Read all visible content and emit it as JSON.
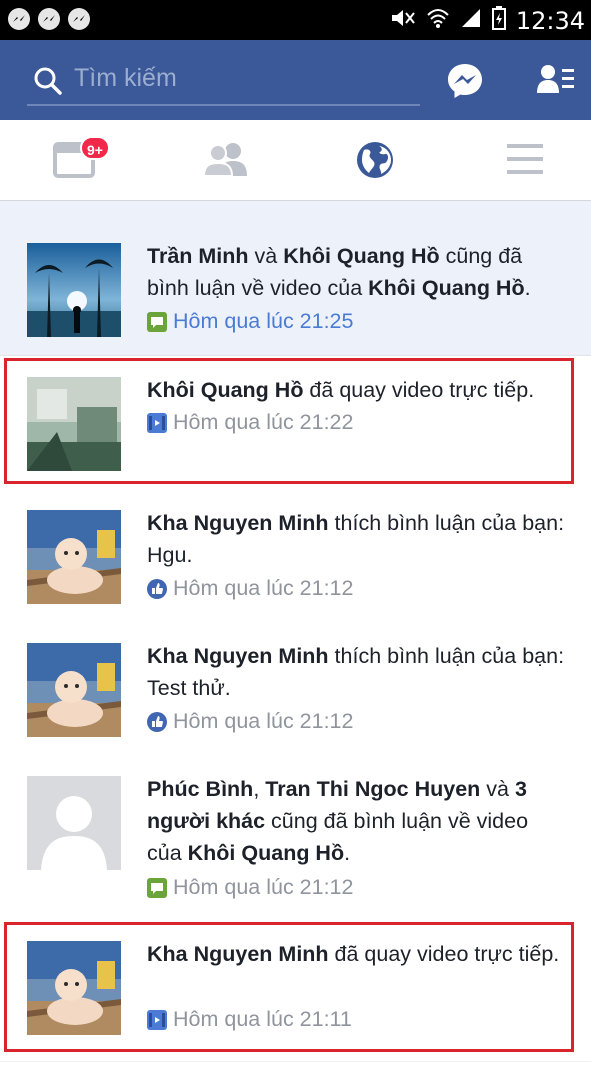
{
  "status_bar": {
    "time": "12:34",
    "icons": [
      "messenger-notification-icon",
      "messenger-notification-icon",
      "messenger-notification-icon",
      "mute-icon",
      "wifi-icon",
      "signal-icon",
      "battery-icon"
    ]
  },
  "header": {
    "search_placeholder": "Tìm kiếm",
    "icons": [
      "search-icon",
      "messenger-icon",
      "friend-requests-icon"
    ]
  },
  "nav": {
    "tabs": [
      {
        "name": "news-feed",
        "icon": "news-feed-icon"
      },
      {
        "name": "friends",
        "icon": "friends-icon"
      },
      {
        "name": "notifications",
        "icon": "globe-icon",
        "active": true
      },
      {
        "name": "menu",
        "icon": "menu-icon"
      }
    ],
    "feed_badge": "9+"
  },
  "colors": {
    "brand": "#3b5998",
    "unread_bg": "#edf2fa",
    "highlight_box": "#d9232d",
    "badge": "#f02849",
    "time_unread": "#4b7bd4",
    "time_read": "#90949c"
  },
  "notifications": [
    {
      "p1_b": "Trần Minh",
      "p2": " và ",
      "p3_b": "Khôi Quang Hồ",
      "p4": " cũng đã bình luận về video của ",
      "p5_b": "Khôi Quang Hồ",
      "p6": ".",
      "time": "Hôm qua lúc 21:25",
      "icon": "comment-icon",
      "unread": true
    },
    {
      "p1_b": "Khôi Quang Hồ",
      "p2": " đã quay video trực tiếp.",
      "time": "Hôm qua lúc 21:22",
      "icon": "video-icon",
      "highlighted": true
    },
    {
      "p1_b": "Kha Nguyen Minh",
      "p2": " thích bình luận của bạn: Hgu.",
      "time": "Hôm qua lúc 21:12",
      "icon": "like-icon"
    },
    {
      "p1_b": "Kha Nguyen Minh",
      "p2": " thích bình luận của bạn: Test thử.",
      "time": "Hôm qua lúc 21:12",
      "icon": "like-icon"
    },
    {
      "p1_b": "Phúc Bình",
      "p2": ", ",
      "p3_b": "Tran Thi Ngoc Huyen",
      "p4": " và ",
      "p5_b": "3 người khác",
      "p6": " cũng đã bình luận về video của ",
      "p7_b": "Khôi Quang Hồ",
      "p8": ".",
      "time": "Hôm qua lúc 21:12",
      "icon": "comment-icon"
    },
    {
      "p1_b": "Kha Nguyen Minh",
      "p2": " đã quay video trực tiếp.",
      "time": "Hôm qua lúc 21:11",
      "icon": "video-icon",
      "highlighted": true
    }
  ]
}
